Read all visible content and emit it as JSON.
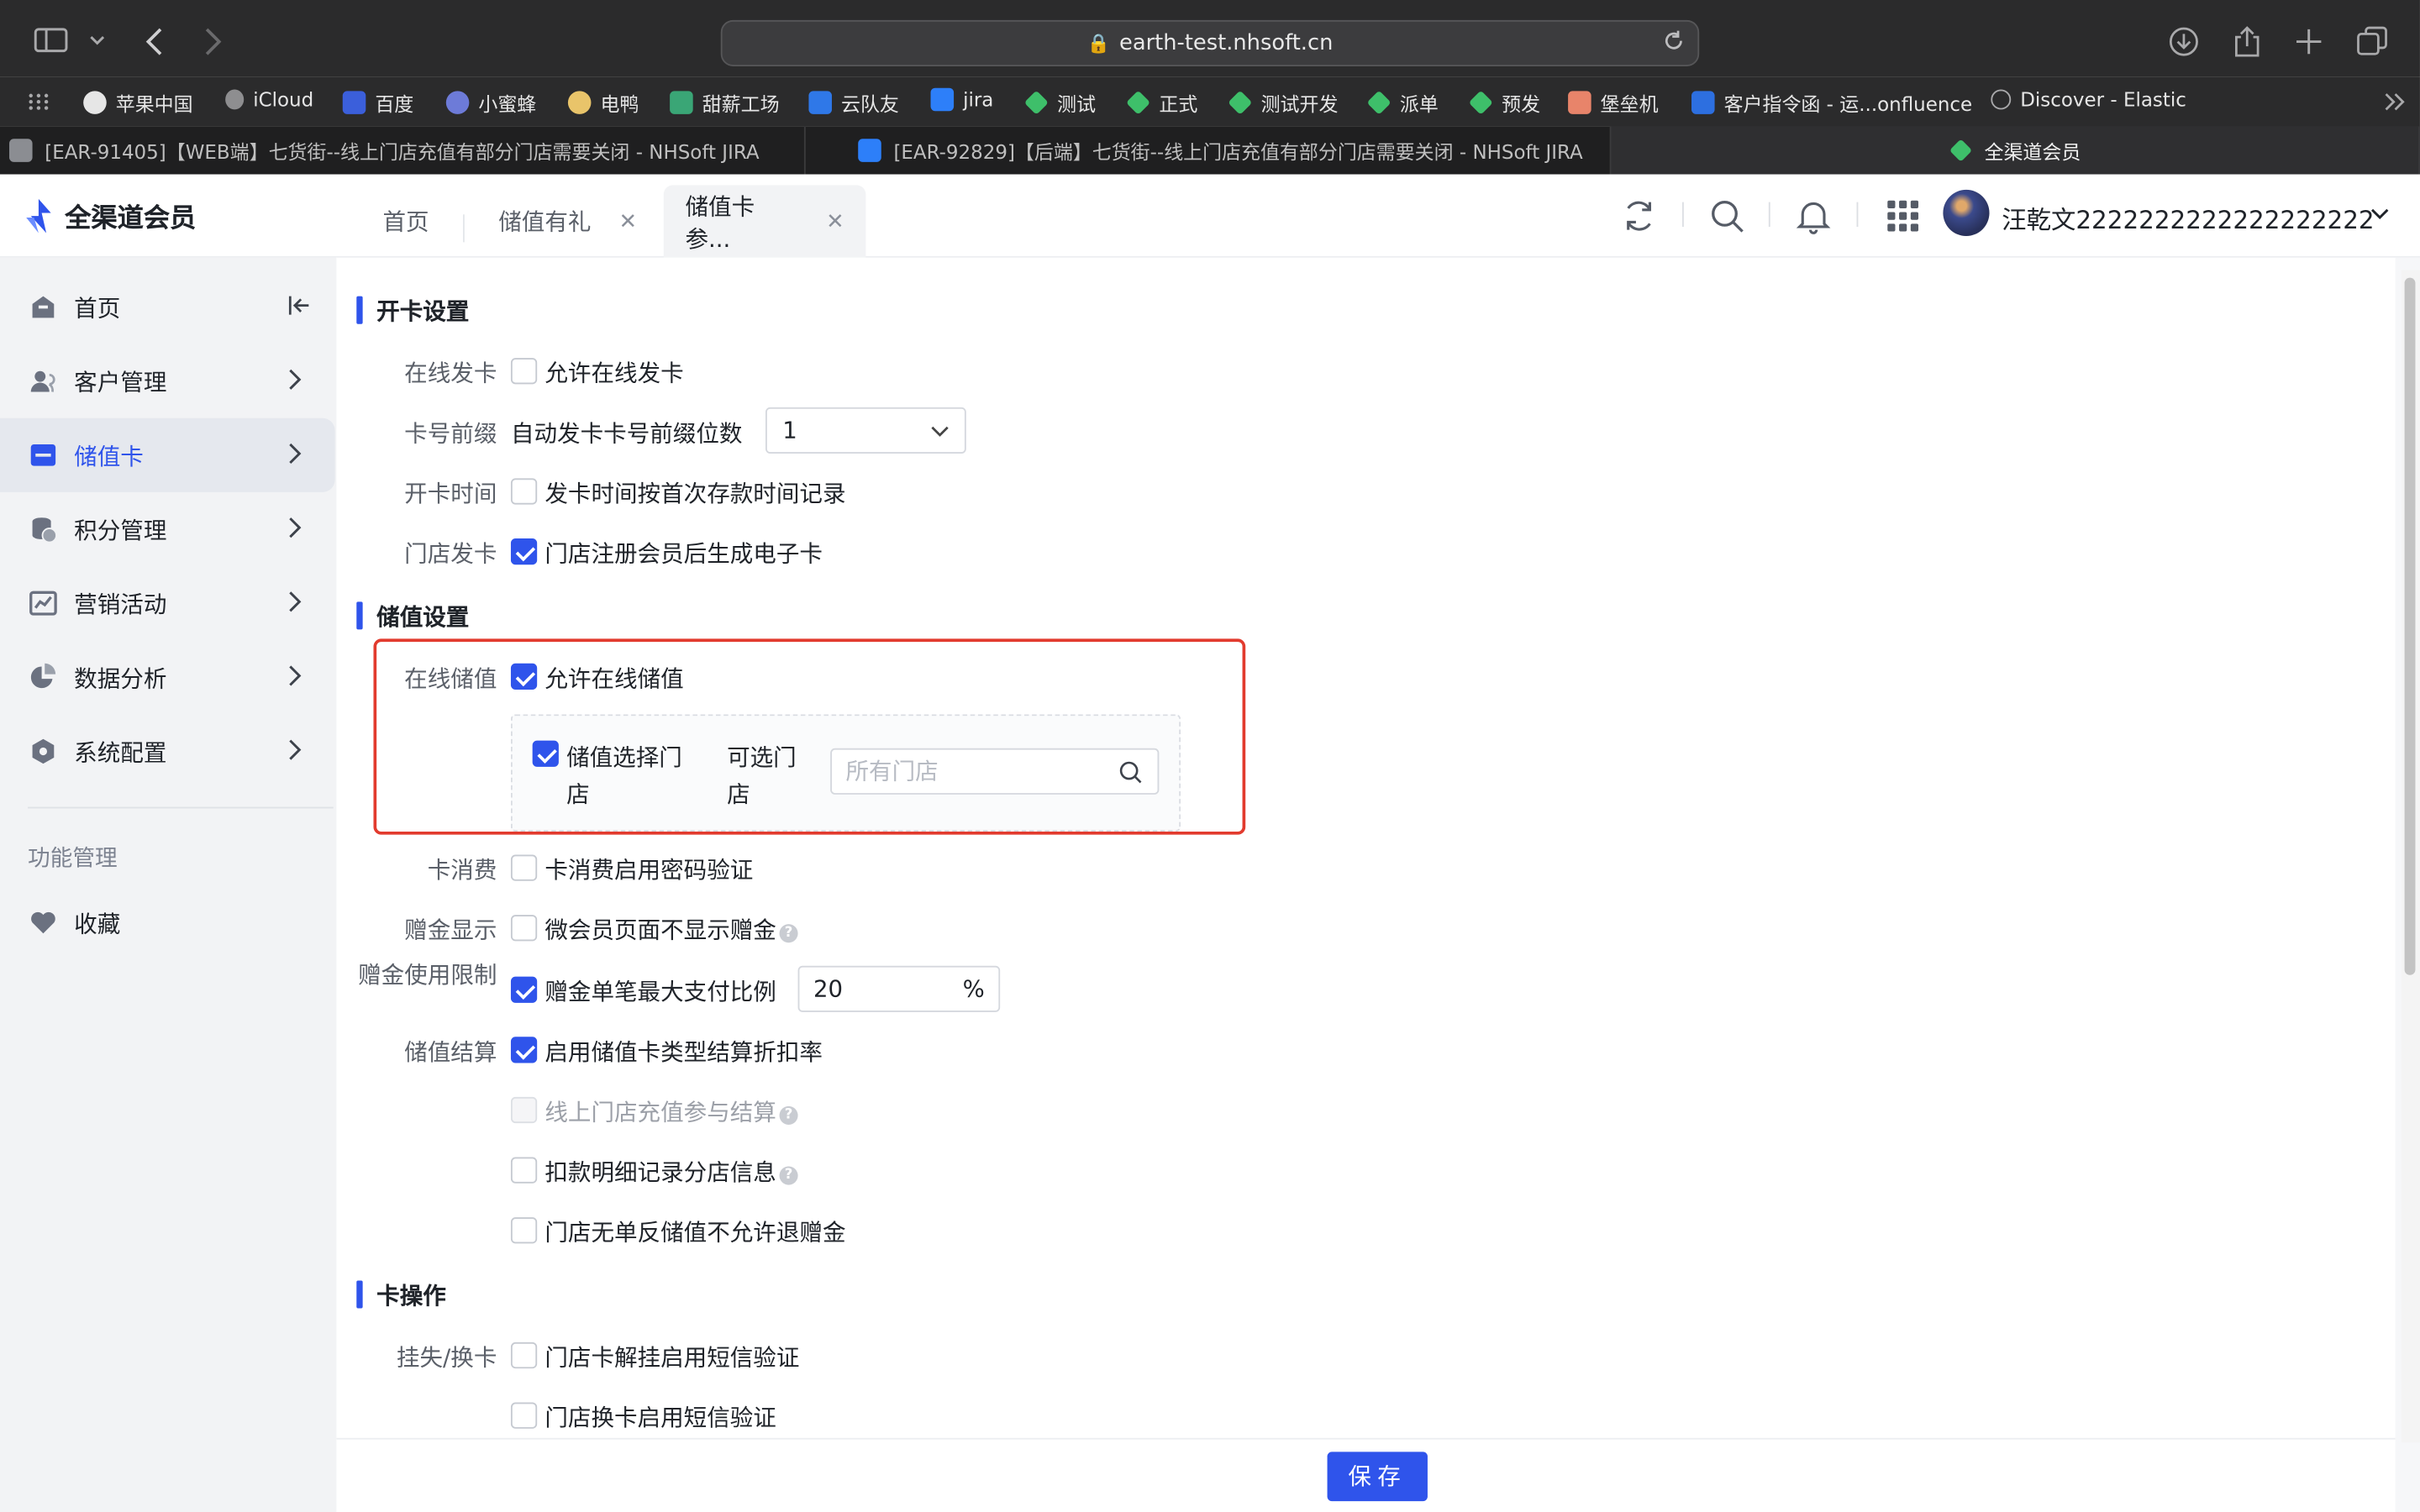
{
  "browser": {
    "url": "earth-test.nhsoft.cn",
    "bookmarks": [
      "苹果中国",
      "iCloud",
      "百度",
      "小蜜蜂",
      "电鸭",
      "甜薪工场",
      "云队友",
      "jira",
      "测试",
      "正式",
      "测试开发",
      "派单",
      "预发",
      "堡垒机",
      "客户指令函 - 运...onfluence",
      "Discover - Elastic"
    ],
    "tabs": [
      "[EAR-91405]【WEB端】七货街--线上门店充值有部分门店需要关闭 - NHSoft JIRA",
      "[EAR-92829]【后端】七货街--线上门店充值有部分门店需要关闭 - NHSoft JIRA",
      "全渠道会员"
    ]
  },
  "app": {
    "logo_text": "全渠道会员",
    "page_tabs": [
      "首页",
      "储值有礼",
      "储值卡参..."
    ],
    "username": "汪乾文2222222222222222222"
  },
  "sidebar": {
    "items": [
      "首页",
      "客户管理",
      "储值卡",
      "积分管理",
      "营销活动",
      "数据分析",
      "系统配置"
    ],
    "group_label": "功能管理",
    "favorites": "收藏"
  },
  "form": {
    "section_card_open": "开卡设置",
    "online_issue_label": "在线发卡",
    "online_issue_text": "允许在线发卡",
    "prefix_label": "卡号前缀",
    "prefix_text": "自动发卡卡号前缀位数",
    "prefix_value": "1",
    "open_time_label": "开卡时间",
    "open_time_text": "发卡时间按首次存款时间记录",
    "store_issue_label": "门店发卡",
    "store_issue_text": "门店注册会员后生成电子卡",
    "section_stored": "储值设置",
    "online_stored_label": "在线储值",
    "online_stored_text": "允许在线储值",
    "select_store_text": "储值选择门店",
    "available_store_label": "可选门店",
    "store_search_placeholder": "所有门店",
    "card_consume_label": "卡消费",
    "card_consume_text": "卡消费启用密码验证",
    "gift_display_label": "赠金显示",
    "gift_display_text": "微会员页面不显示赠金",
    "gift_limit_label": "赠金使用限制",
    "gift_limit_text": "赠金单笔最大支付比例",
    "gift_limit_value": "20",
    "gift_limit_suffix": "%",
    "settle_label": "储值结算",
    "settle_text_1": "启用储值卡类型结算折扣率",
    "settle_text_2": "线上门店充值参与结算",
    "settle_text_3": "扣款明细记录分店信息",
    "settle_text_4": "门店无单反储值不允许退赠金",
    "section_card_ops": "卡操作",
    "lost_label": "挂失/换卡",
    "lost_text_1": "门店卡解挂启用短信验证",
    "lost_text_2": "门店换卡启用短信验证",
    "save_button": "保存"
  },
  "colors": {
    "accent": "#2f54eb",
    "highlight_frame": "#e23b2e"
  }
}
